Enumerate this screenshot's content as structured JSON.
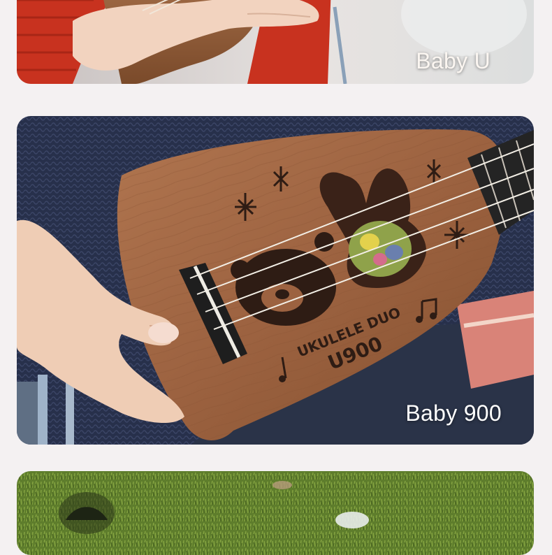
{
  "cards": [
    {
      "label": "Baby U"
    },
    {
      "label": "Baby 900"
    },
    {
      "label": ""
    }
  ],
  "engraving": {
    "line1": "UKULELE DUO",
    "line2": "U900"
  },
  "colors": {
    "page_background": "#f4f1f2",
    "card_label": "#ffffff",
    "ukulele_wood": "#9c6240",
    "sweater_blue": "#2a3350",
    "sweater_red": "#c8321f",
    "grass_green": "#5e7d2c"
  }
}
